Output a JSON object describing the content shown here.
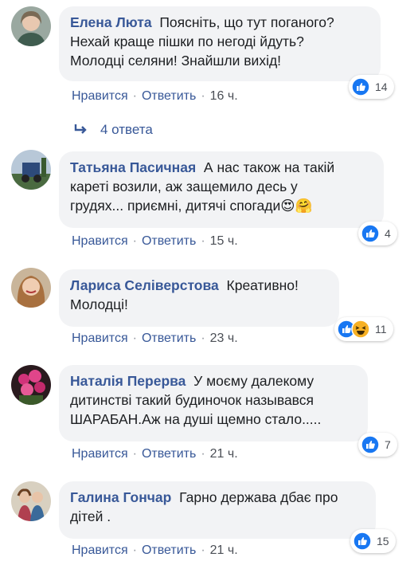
{
  "comments": [
    {
      "author": "Елена Люта",
      "text": "Поясніть, що тут поганого?\nНехай краще пішки по негоді йдуть?\nМолодці селяни! Знайшли вихід!",
      "like_label": "Нравится",
      "reply_label": "Ответить",
      "time": "16 ч.",
      "reaction_count": "14",
      "reactions": [
        "like-icon"
      ],
      "replies_label": "4 ответа"
    },
    {
      "author": "Татьяна Пасичная",
      "text": "А нас також на такій\nкареті возили, аж защемило десь у\nгрудях... приємні, дитячі спогади😍🤗",
      "like_label": "Нравится",
      "reply_label": "Ответить",
      "time": "15 ч.",
      "reaction_count": "4",
      "reactions": [
        "like-icon"
      ]
    },
    {
      "author": "Лариса Селіверстова",
      "text": "Креативно!\nМолодці!",
      "like_label": "Нравится",
      "reply_label": "Ответить",
      "time": "23 ч.",
      "reaction_count": "11",
      "reactions": [
        "like-icon",
        "haha-icon"
      ]
    },
    {
      "author": "Наталія Перерва",
      "text": "У моєму далекому\nдитинстві такий будиночок назывався\nШАРАБАН.Аж на душі щемно стало.....",
      "like_label": "Нравится",
      "reply_label": "Ответить",
      "time": "21 ч.",
      "reaction_count": "7",
      "reactions": [
        "like-icon"
      ]
    },
    {
      "author": "Галина Гончар",
      "text": "Гарно держава дбає про\nдітей .",
      "like_label": "Нравится",
      "reply_label": "Ответить",
      "time": "21 ч.",
      "reaction_count": "15",
      "reactions": [
        "like-icon"
      ]
    }
  ],
  "colors": {
    "link": "#385898",
    "bubble": "#f2f3f5",
    "like_blue": "#1877f2"
  }
}
